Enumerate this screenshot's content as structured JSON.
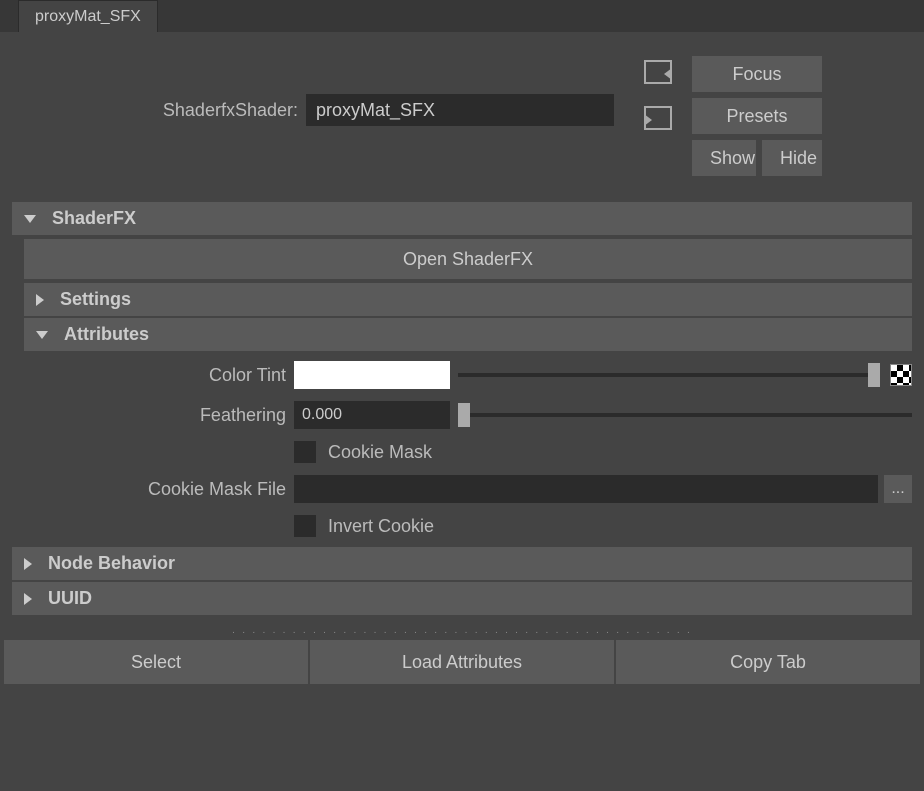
{
  "tab": {
    "label": "proxyMat_SFX"
  },
  "header": {
    "name_label": "ShaderfxShader:",
    "name_value": "proxyMat_SFX",
    "focus": "Focus",
    "presets": "Presets",
    "show": "Show",
    "hide": "Hide"
  },
  "sections": {
    "shaderfx": {
      "title": "ShaderFX",
      "open_btn": "Open ShaderFX"
    },
    "settings": {
      "title": "Settings"
    },
    "attributes": {
      "title": "Attributes",
      "color_tint_label": "Color Tint",
      "color_tint_value": "#FFFFFF",
      "color_tint_slider": 1.0,
      "feathering_label": "Feathering",
      "feathering_value": "0.000",
      "feathering_slider": 0.0,
      "cookie_mask_label": "Cookie Mask",
      "cookie_mask_checked": false,
      "cookie_mask_file_label": "Cookie Mask File",
      "cookie_mask_file_value": "",
      "browse_label": "...",
      "invert_cookie_label": "Invert Cookie",
      "invert_cookie_checked": false
    },
    "node_behavior": {
      "title": "Node Behavior"
    },
    "uuid": {
      "title": "UUID"
    }
  },
  "footer": {
    "select": "Select",
    "load": "Load Attributes",
    "copy": "Copy Tab"
  }
}
